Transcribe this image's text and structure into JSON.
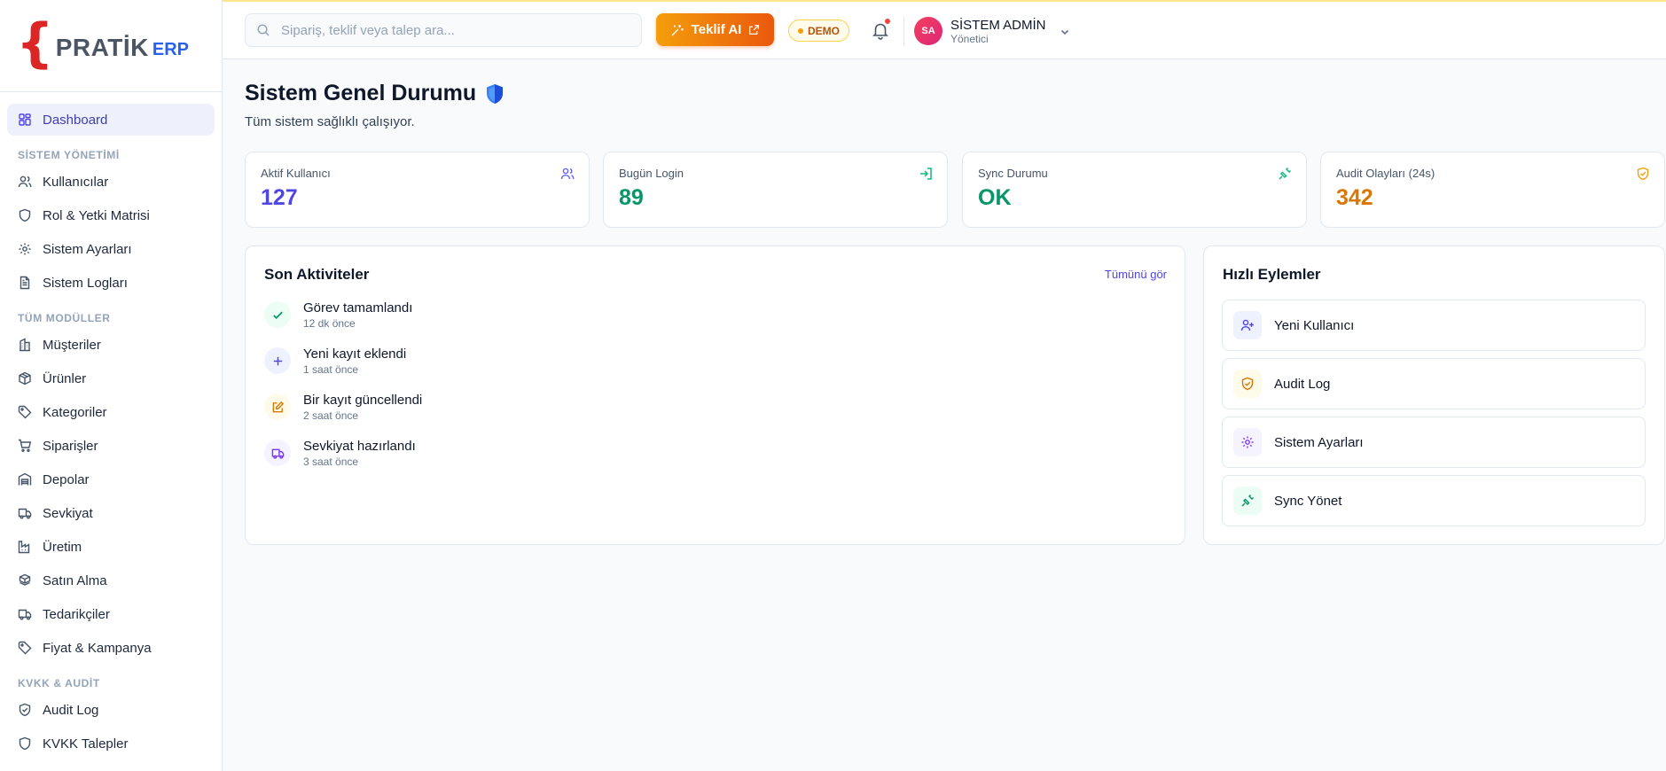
{
  "brand": {
    "logo_word": "PRATİK",
    "logo_suffix": "ERP"
  },
  "sidebar": {
    "items": [
      {
        "label": "Dashboard",
        "icon": "grid-icon",
        "active": true
      }
    ],
    "sections": [
      {
        "title": "SİSTEM YÖNETİMİ",
        "items": [
          {
            "label": "Kullanıcılar",
            "icon": "users-icon"
          },
          {
            "label": "Rol & Yetki Matrisi",
            "icon": "shield-icon"
          },
          {
            "label": "Sistem Ayarları",
            "icon": "gear-icon"
          },
          {
            "label": "Sistem Logları",
            "icon": "file-text-icon"
          }
        ]
      },
      {
        "title": "TÜM MODÜLLER",
        "items": [
          {
            "label": "Müşteriler",
            "icon": "building-icon"
          },
          {
            "label": "Ürünler",
            "icon": "package-icon"
          },
          {
            "label": "Kategoriler",
            "icon": "tag-icon"
          },
          {
            "label": "Siparişler",
            "icon": "cart-icon"
          },
          {
            "label": "Depolar",
            "icon": "warehouse-icon"
          },
          {
            "label": "Sevkiyat",
            "icon": "truck-icon"
          },
          {
            "label": "Üretim",
            "icon": "factory-icon"
          },
          {
            "label": "Satın Alma",
            "icon": "boxes-icon"
          },
          {
            "label": "Tedarikçiler",
            "icon": "truck-icon"
          },
          {
            "label": "Fiyat & Kampanya",
            "icon": "tag-icon"
          }
        ]
      },
      {
        "title": "KVKK & AUDİT",
        "items": [
          {
            "label": "Audit Log",
            "icon": "shield-check-icon"
          },
          {
            "label": "KVKK Talepler",
            "icon": "shield-icon"
          }
        ]
      }
    ]
  },
  "topbar": {
    "search_placeholder": "Sipariş, teklif veya talep ara...",
    "teklif_label": "Teklif AI",
    "demo_label": "DEMO",
    "user": {
      "initials": "SA",
      "name": "SİSTEM ADMİN",
      "role": "Yönetici"
    }
  },
  "header": {
    "title": "Sistem Genel Durumu",
    "subtitle": "Tüm sistem sağlıklı çalışıyor."
  },
  "stats": [
    {
      "label": "Aktif Kullanıcı",
      "value": "127",
      "color": "#4f46e5",
      "icon": "users-icon"
    },
    {
      "label": "Bugün Login",
      "value": "89",
      "color": "#059669",
      "icon": "login-icon"
    },
    {
      "label": "Sync Durumu",
      "value": "OK",
      "color": "#059669",
      "icon": "plug-icon"
    },
    {
      "label": "Audit Olayları (24s)",
      "value": "342",
      "color": "#d97706",
      "icon": "shield-check-icon"
    }
  ],
  "activities": {
    "title": "Son Aktiviteler",
    "see_all": "Tümünü gör",
    "items": [
      {
        "title": "Görev tamamlandı",
        "time": "12 dk önce",
        "icon": "check-icon"
      },
      {
        "title": "Yeni kayıt eklendi",
        "time": "1 saat önce",
        "icon": "plus-icon"
      },
      {
        "title": "Bir kayıt güncellendi",
        "time": "2 saat önce",
        "icon": "edit-icon"
      },
      {
        "title": "Sevkiyat hazırlandı",
        "time": "3 saat önce",
        "icon": "truck-icon"
      }
    ]
  },
  "quick_actions": {
    "title": "Hızlı Eylemler",
    "items": [
      {
        "label": "Yeni Kullanıcı",
        "icon": "user-plus-icon"
      },
      {
        "label": "Audit Log",
        "icon": "shield-check-icon"
      },
      {
        "label": "Sistem Ayarları",
        "icon": "gear-icon"
      },
      {
        "label": "Sync Yönet",
        "icon": "plug-icon"
      }
    ]
  }
}
